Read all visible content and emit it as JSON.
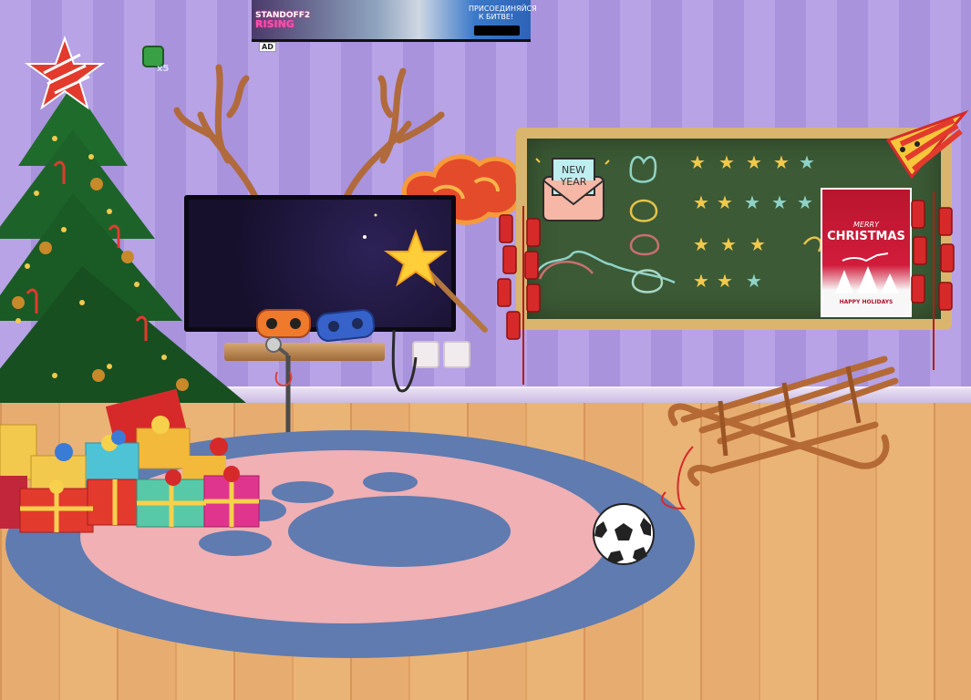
{
  "ad_banner": {
    "brand_line1": "STANDOFF2",
    "brand_line2": "RISING",
    "cta": "ПРИСОЕДИНЯЙСЯ К БИТВЕ!",
    "store_badge": "Google Play",
    "ad_tag": "AD"
  },
  "tv": {
    "badge_count": "x5"
  },
  "board": {
    "new_year_line1": "NEW",
    "new_year_line2": "YEAR",
    "star_rows": [
      {
        "filled": 5,
        "empty": 0
      },
      {
        "filled": 2,
        "empty": 3
      },
      {
        "filled": 3,
        "empty": 0
      },
      {
        "filled": 2,
        "empty": 1
      }
    ],
    "star_filled_color": "#f2c94c",
    "star_empty_color": "#8fd3c8"
  },
  "xmas_card": {
    "line1": "MERRY",
    "line2": "CHRISTMAS",
    "line3": "HAPPY HOLIDAYS"
  },
  "icons": [
    "christmas-tree-icon",
    "tree-topper-star-icon",
    "antlers-icon",
    "cloud-ornament-icon",
    "party-hat-icon",
    "firecracker-icon",
    "gamepad-orange-icon",
    "gamepad-blue-icon",
    "magic-wand-icon",
    "sled-icon",
    "soccer-ball-icon",
    "gift-box-icon"
  ],
  "colors": {
    "wall": "#b7a3e6",
    "floor": "#e7ad70",
    "rug_outer": "#5f7bb0",
    "rug_inner": "#f0b0b4",
    "board": "#3c5a35",
    "frame": "#d9b56d"
  }
}
